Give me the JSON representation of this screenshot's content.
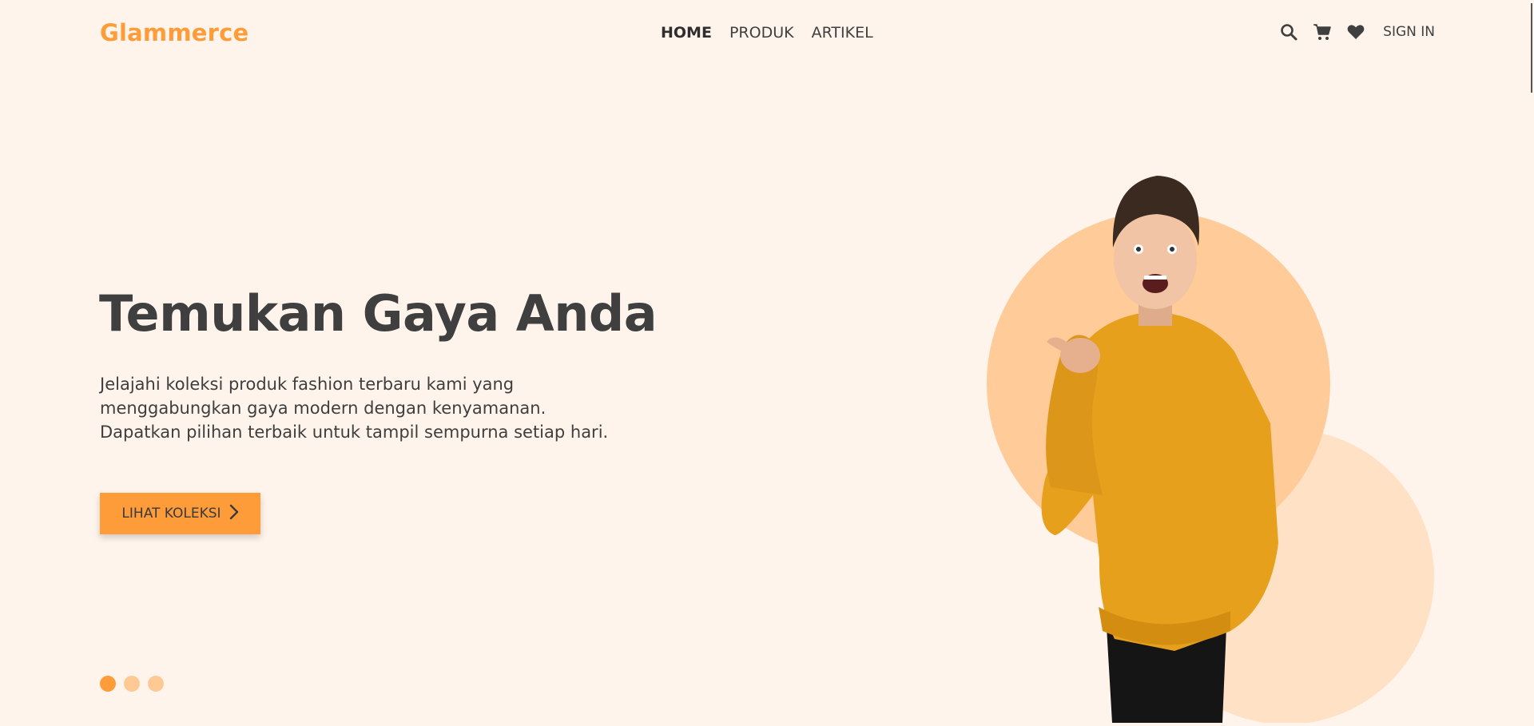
{
  "brand": {
    "name": "Glammerce"
  },
  "nav": {
    "links": [
      {
        "label": "HOME",
        "active": true
      },
      {
        "label": "PRODUK",
        "active": false
      },
      {
        "label": "ARTIKEL",
        "active": false
      }
    ],
    "icons": [
      "search-icon",
      "cart-icon",
      "heart-icon"
    ],
    "signin_label": "SIGN IN"
  },
  "hero": {
    "title": "Temukan Gaya Anda",
    "description": "Jelajahi koleksi produk fashion terbaru kami yang menggabungkan gaya modern dengan kenyamanan. Dapatkan pilihan terbaik untuk tampil sempurna setiap hari.",
    "cta_label": "LIHAT KOLEKSI",
    "cta_icon": "chevron-right-icon"
  },
  "carousel": {
    "slide_count": 3,
    "active_index": 1
  },
  "colors": {
    "background": "#fff4ec",
    "accent": "#ff9c3a",
    "accent_light": "#ffc994",
    "text_dark": "#3f3f3f"
  }
}
